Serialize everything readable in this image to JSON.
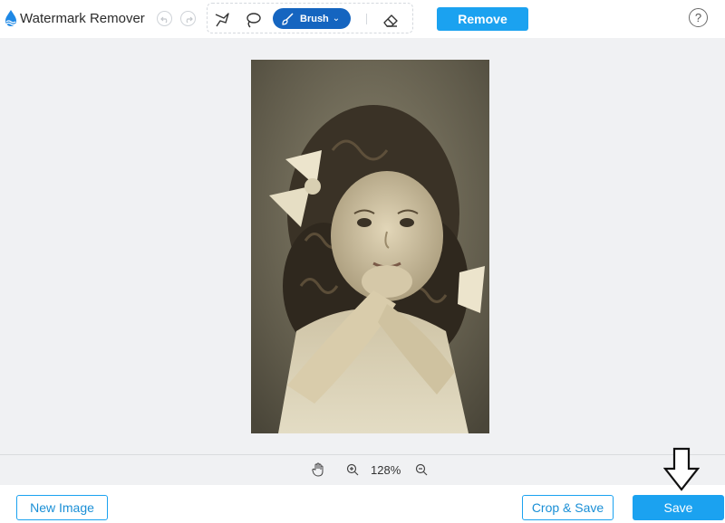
{
  "app": {
    "title": "Watermark Remover"
  },
  "toolbar": {
    "brush_label": "Brush",
    "remove_label": "Remove",
    "help_label": "?",
    "icons": [
      "undo-icon",
      "redo-icon",
      "polygonal-lasso-icon",
      "lasso-icon",
      "brush-icon",
      "chevron-down-icon",
      "eraser-icon",
      "help-icon"
    ]
  },
  "zoom": {
    "level": "128%"
  },
  "footer": {
    "new_image_label": "New Image",
    "crop_save_label": "Crop & Save",
    "save_label": "Save"
  },
  "colors": {
    "accent": "#1ba2f0",
    "brush_active": "#1565c0",
    "canvas_bg": "#f0f1f3"
  }
}
